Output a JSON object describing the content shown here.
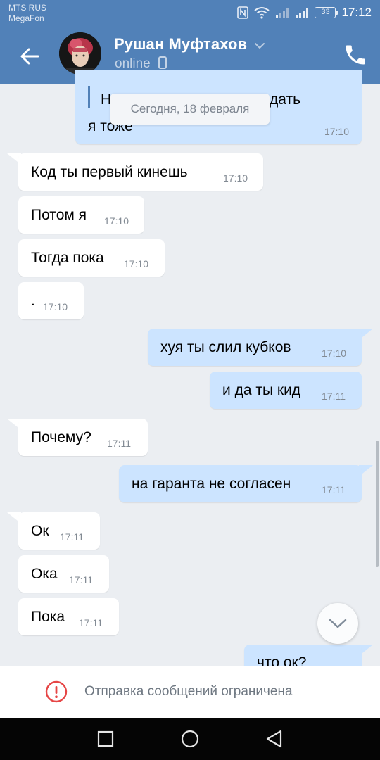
{
  "status_bar": {
    "carrier_1": "MTS RUS",
    "carrier_2": "MegaFon",
    "battery": "33",
    "time": "17:12",
    "icons": [
      "nfc-icon",
      "wifi-icon",
      "signal-icon",
      "signal-icon",
      "battery-icon"
    ]
  },
  "header": {
    "contact_name": "Рушан Муфтахов",
    "status": "online",
    "status_device_icon": "phone-device-icon",
    "back_icon": "arrow-left-icon",
    "call_icon": "phone-icon",
    "accent_color": "#5181b8"
  },
  "date_separator": "Сегодня, 18 февраля",
  "messages": [
    {
      "direction": "out",
      "text": "я тоже",
      "time": "17:10",
      "partial_text": "Н",
      "partial_text_right": "дать"
    },
    {
      "direction": "in",
      "text": "Код ты первый кинешь",
      "time": "17:10"
    },
    {
      "direction": "in",
      "text": "Потом я",
      "time": "17:10"
    },
    {
      "direction": "in",
      "text": "Тогда пока",
      "time": "17:10"
    },
    {
      "direction": "in",
      "text": ".",
      "time": "17:10"
    },
    {
      "direction": "out",
      "text": "хуя ты слил кубков",
      "time": "17:10"
    },
    {
      "direction": "out",
      "text": "и да ты кид",
      "time": "17:11"
    },
    {
      "direction": "in",
      "text": "Почему?",
      "time": "17:11"
    },
    {
      "direction": "out",
      "text": "на гаранта не согласен",
      "time": "17:11"
    },
    {
      "direction": "in",
      "text": "Ок",
      "time": "17:11"
    },
    {
      "direction": "in",
      "text": "Ока",
      "time": "17:11"
    },
    {
      "direction": "in",
      "text": "Пока",
      "time": "17:11"
    },
    {
      "direction": "out",
      "text": "что ок?",
      "time": ""
    }
  ],
  "restricted": {
    "text": "Отправка сообщений ограничена",
    "icon": "alert-circle-icon",
    "icon_color": "#e64646"
  },
  "nav": {
    "buttons": [
      "recent-apps-icon",
      "home-icon",
      "back-triangle-icon"
    ]
  }
}
